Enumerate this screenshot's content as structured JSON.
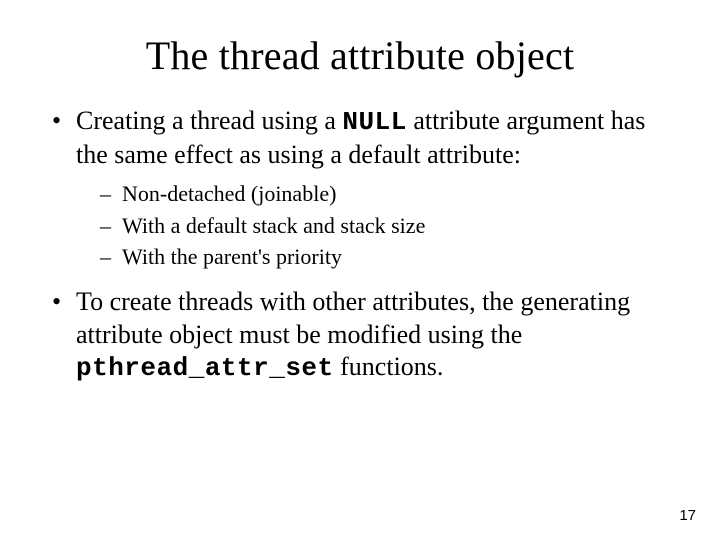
{
  "title": "The thread attribute object",
  "bullet1": {
    "pre": "Creating a thread using a ",
    "code": "NULL",
    "post": "  attribute argument has the same effect as using a default attribute:"
  },
  "sub": [
    "Non-detached (joinable)",
    "With a default stack and stack size",
    "With the parent's priority"
  ],
  "bullet2": {
    "pre": "To create threads with other attributes, the generating attribute object must be modified using the ",
    "code": "pthread_attr_set",
    "post": " functions."
  },
  "page_number": "17"
}
